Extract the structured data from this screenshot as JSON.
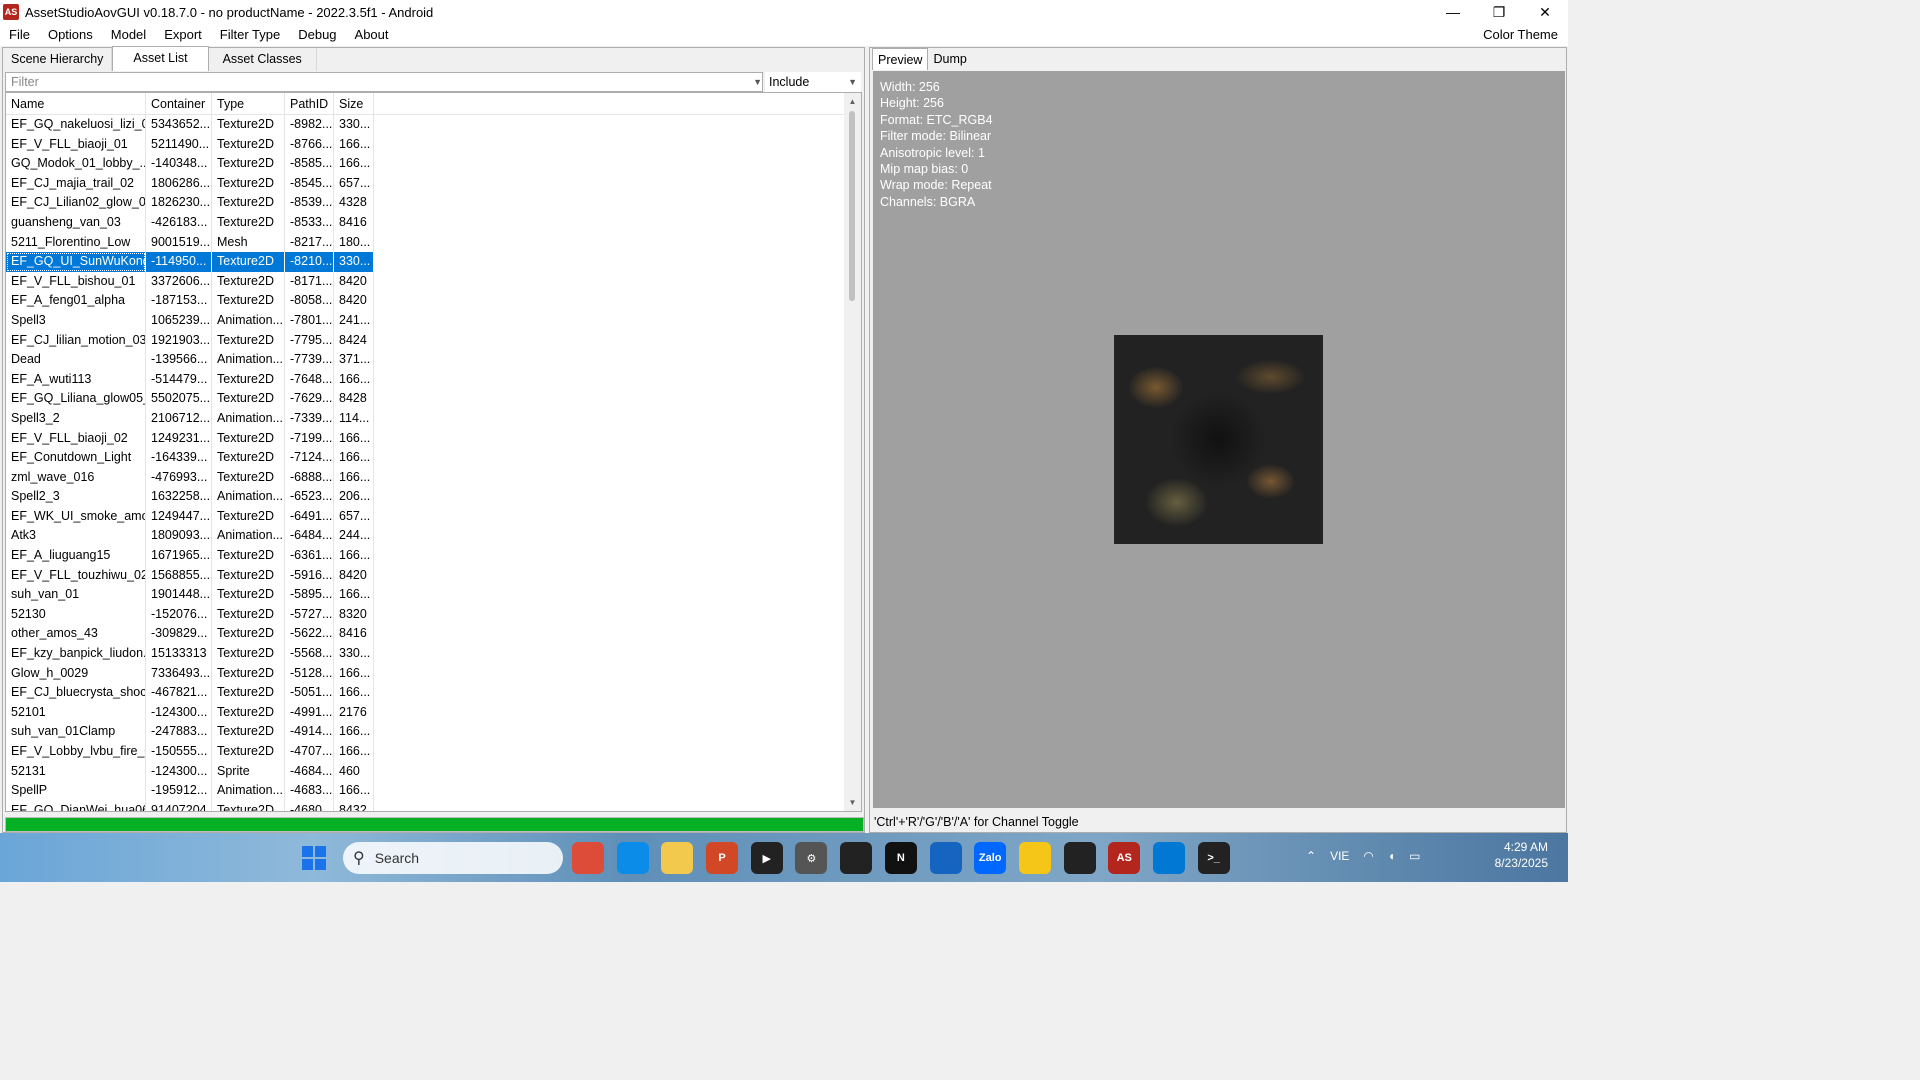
{
  "window": {
    "title": "AssetStudioAovGUI v0.18.7.0 - no productName - 2022.3.5f1 - Android",
    "icon_text": "AS",
    "minimize_glyph": "—",
    "restore_glyph": "❐",
    "close_glyph": "✕"
  },
  "menu": {
    "items": [
      "File",
      "Options",
      "Model",
      "Export",
      "Filter Type",
      "Debug",
      "About"
    ],
    "right": "Color Theme"
  },
  "left_tabs": [
    "Scene Hierarchy",
    "Asset List",
    "Asset Classes"
  ],
  "filter": {
    "placeholder": "Filter",
    "mode": "Include"
  },
  "columns": [
    "Name",
    "Container",
    "Type",
    "PathID",
    "Size"
  ],
  "rows": [
    [
      "EF_GQ_nakeluosi_lizi_0...",
      "5343652...",
      "Texture2D",
      "-8982...",
      "330..."
    ],
    [
      "EF_V_FLL_biaoji_01",
      "5211490...",
      "Texture2D",
      "-8766...",
      "166..."
    ],
    [
      "GQ_Modok_01_lobby_...",
      "-140348...",
      "Texture2D",
      "-8585...",
      "166..."
    ],
    [
      "EF_CJ_majia_trail_02",
      "1806286...",
      "Texture2D",
      "-8545...",
      "657..."
    ],
    [
      "EF_CJ_Lilian02_glow_04",
      "1826230...",
      "Texture2D",
      "-8539...",
      "4328"
    ],
    [
      "guansheng_van_03",
      "-426183...",
      "Texture2D",
      "-8533...",
      "8416"
    ],
    [
      "5211_Florentino_Low",
      "9001519...",
      "Mesh",
      "-8217...",
      "180..."
    ],
    [
      "EF_GQ_UI_SunWuKong...",
      "-114950...",
      "Texture2D",
      "-8210...",
      "330..."
    ],
    [
      "EF_V_FLL_bishou_01",
      "3372606...",
      "Texture2D",
      "-8171...",
      "8420"
    ],
    [
      "EF_A_feng01_alpha",
      "-187153...",
      "Texture2D",
      "-8058...",
      "8420"
    ],
    [
      "Spell3",
      "1065239...",
      "Animation...",
      "-7801...",
      "241..."
    ],
    [
      "EF_CJ_lilian_motion_03",
      "1921903...",
      "Texture2D",
      "-7795...",
      "8424"
    ],
    [
      "Dead",
      "-139566...",
      "Animation...",
      "-7739...",
      "371..."
    ],
    [
      "EF_A_wuti113",
      "-514479...",
      "Texture2D",
      "-7648...",
      "166..."
    ],
    [
      "EF_GQ_Liliana_glow05_...",
      "5502075...",
      "Texture2D",
      "-7629...",
      "8428"
    ],
    [
      "Spell3_2",
      "2106712...",
      "Animation...",
      "-7339...",
      "114..."
    ],
    [
      "EF_V_FLL_biaoji_02",
      "1249231...",
      "Texture2D",
      "-7199...",
      "166..."
    ],
    [
      "EF_Conutdown_Light",
      "-164339...",
      "Texture2D",
      "-7124...",
      "166..."
    ],
    [
      "zml_wave_016",
      "-476993...",
      "Texture2D",
      "-6888...",
      "166..."
    ],
    [
      "Spell2_3",
      "1632258...",
      "Animation...",
      "-6523...",
      "206..."
    ],
    [
      "EF_WK_UI_smoke_amo...",
      "1249447...",
      "Texture2D",
      "-6491...",
      "657..."
    ],
    [
      "Atk3",
      "1809093...",
      "Animation...",
      "-6484...",
      "244..."
    ],
    [
      "EF_A_liuguang15",
      "1671965...",
      "Texture2D",
      "-6361...",
      "166..."
    ],
    [
      "EF_V_FLL_touzhiwu_02",
      "1568855...",
      "Texture2D",
      "-5916...",
      "8420"
    ],
    [
      "suh_van_01",
      "1901448...",
      "Texture2D",
      "-5895...",
      "166..."
    ],
    [
      "52130",
      "-152076...",
      "Texture2D",
      "-5727...",
      "8320"
    ],
    [
      "other_amos_43",
      "-309829...",
      "Texture2D",
      "-5622...",
      "8416"
    ],
    [
      "EF_kzy_banpick_liudon...",
      "15133313",
      "Texture2D",
      "-5568...",
      "330..."
    ],
    [
      "Glow_h_0029",
      "7336493...",
      "Texture2D",
      "-5128...",
      "166..."
    ],
    [
      "EF_CJ_bluecrysta_shock...",
      "-467821...",
      "Texture2D",
      "-5051...",
      "166..."
    ],
    [
      "52101",
      "-124300...",
      "Texture2D",
      "-4991...",
      "2176"
    ],
    [
      "suh_van_01Clamp",
      "-247883...",
      "Texture2D",
      "-4914...",
      "166..."
    ],
    [
      "EF_V_Lobby_lvbu_fire_03",
      "-150555...",
      "Texture2D",
      "-4707...",
      "166..."
    ],
    [
      "52131",
      "-124300...",
      "Sprite",
      "-4684...",
      "460"
    ],
    [
      "SpellP",
      "-195912...",
      "Animation...",
      "-4683...",
      "166..."
    ],
    [
      "EF_GQ_DianWei_hua06",
      "91407204",
      "Texture2D",
      "-4680...",
      "8432"
    ]
  ],
  "selected_row": 7,
  "progress_fraction": 1.0,
  "right_tabs": [
    "Preview",
    "Dump"
  ],
  "preview_info": [
    "Width: 256",
    "Height: 256",
    "Format: ETC_RGB4",
    "Filter mode: Bilinear",
    "Anisotropic level: 1",
    "Mip map bias: 0",
    "Wrap mode: Repeat",
    "Channels: BGRA"
  ],
  "status_text": "'Ctrl'+'R'/'G'/'B'/'A' for Channel Toggle",
  "taskbar": {
    "search_label": "Search",
    "lang": "VIE",
    "time": "4:29 AM",
    "date": "8/23/2025",
    "apps": [
      "chrome-icon",
      "edge-icon",
      "file-explorer-icon",
      "powerpoint-icon",
      "media-player-icon",
      "settings-icon",
      "unity-icon",
      "notion-icon",
      "notepad-icon",
      "zalo-icon",
      "app-icon",
      "unity-hub-icon",
      "assetstudio-icon",
      "vscode-icon",
      "terminal-icon"
    ],
    "app_labels": [
      "",
      "",
      "",
      "P",
      "▶",
      "⚙",
      "",
      "N",
      "",
      "Zalo",
      "",
      "",
      "AS",
      "",
      ">_"
    ],
    "app_colors": [
      "#dd4b39",
      "#0c8ce9",
      "#f2c94c",
      "#d24726",
      "#222",
      "#555",
      "#222",
      "#111",
      "#1565c0",
      "#0068ff",
      "#f5c518",
      "#222",
      "#b3261e",
      "#0078d4",
      "#222"
    ]
  }
}
